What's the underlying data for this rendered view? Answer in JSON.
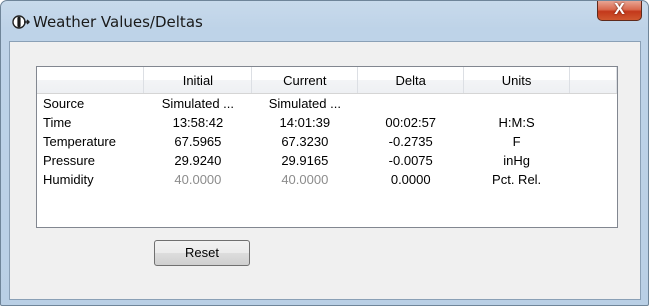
{
  "window": {
    "title": "Weather Values/Deltas",
    "close_label": "X"
  },
  "grid": {
    "columns": [
      "",
      "Initial",
      "Current",
      "Delta",
      "Units",
      ""
    ],
    "rows": [
      {
        "label": "Source",
        "initial": "Simulated ...",
        "current": "Simulated ...",
        "delta": "",
        "units": ""
      },
      {
        "label": "Time",
        "initial": "13:58:42",
        "current": "14:01:39",
        "delta": "00:02:57",
        "units": "H:M:S"
      },
      {
        "label": "Temperature",
        "initial": "67.5965",
        "current": "67.3230",
        "delta": "-0.2735",
        "units": "F"
      },
      {
        "label": "Pressure",
        "initial": "29.9240",
        "current": "29.9165",
        "delta": "-0.0075",
        "units": "inHg"
      },
      {
        "label": "Humidity",
        "initial": "40.0000",
        "current": "40.0000",
        "delta": "0.0000",
        "units": "Pct. Rel."
      }
    ]
  },
  "buttons": {
    "reset_label": "Reset"
  },
  "colors": {
    "greyed_text": "#8c8c8c"
  }
}
